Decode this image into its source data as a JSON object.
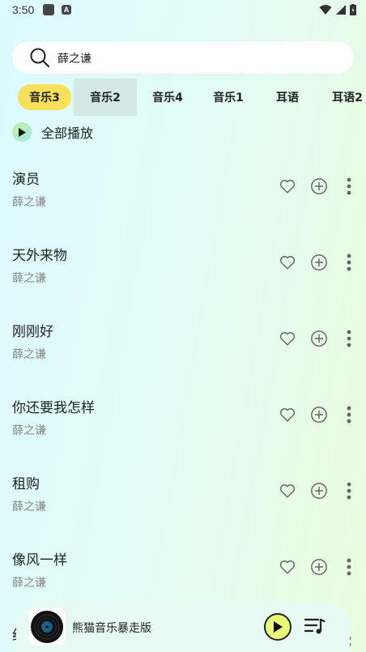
{
  "status_bar": {
    "time": "3:50",
    "notif_icon_letter": "A"
  },
  "search": {
    "value": "薛之谦"
  },
  "tabs": [
    {
      "label": "音乐3"
    },
    {
      "label": "音乐2"
    },
    {
      "label": "音乐4"
    },
    {
      "label": "音乐1"
    },
    {
      "label": "耳语"
    },
    {
      "label": "耳语2"
    }
  ],
  "play_all": {
    "label": "全部播放"
  },
  "songs": [
    {
      "title": "演员",
      "artist": "薛之谦"
    },
    {
      "title": "天外来物",
      "artist": "薛之谦"
    },
    {
      "title": "刚刚好",
      "artist": "薛之谦"
    },
    {
      "title": "你还要我怎样",
      "artist": "薛之谦"
    },
    {
      "title": "租购",
      "artist": "薛之谦"
    },
    {
      "title": "像风一样",
      "artist": "薛之谦"
    }
  ],
  "peek_song": {
    "title_fragment": "约"
  },
  "player": {
    "title": "熊猫音乐暴走版"
  },
  "colors": {
    "active_tab": "#f8e05a",
    "play_button": "#e9ff7a",
    "artist_text": "#888888"
  }
}
